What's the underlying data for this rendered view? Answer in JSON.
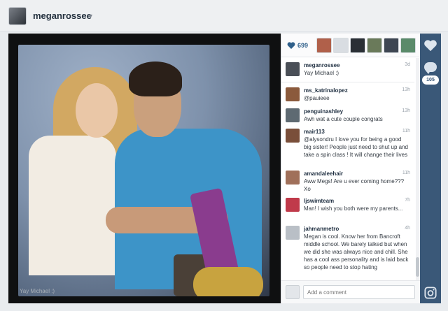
{
  "header": {
    "username": "meganrossee",
    "caret": "▾"
  },
  "photo": {
    "caption_overlay": "Yay Michael :)"
  },
  "likes": {
    "count": "699"
  },
  "comments": [
    {
      "user": "meganrossee",
      "text": "Yay Michael :)",
      "time": "3d",
      "avatar_color": "#4a4f57"
    },
    {
      "user": "ms_katrinalopez",
      "text": "@pauieee",
      "time": "13h",
      "avatar_color": "#8b5a3c"
    },
    {
      "user": "penguinashley",
      "text": "Awh wat a cute couple congrats",
      "time": "13h",
      "avatar_color": "#5e6a72"
    },
    {
      "user": "mair113",
      "text": "@alysondru I love you for being a good big sister! People just need to shut up and take a spin class ! It will change their lives",
      "time": "11h",
      "avatar_color": "#7a4f3a"
    },
    {
      "user": "amandaleehair",
      "text": "Aww Megs! Are u ever coming home??? Xo",
      "time": "11h",
      "avatar_color": "#a0705a"
    },
    {
      "user": "ljswimteam",
      "text": "Man! I wish you both were my parents...",
      "time": "7h",
      "avatar_color": "#c03a4a"
    },
    {
      "user": "jahmanmetro",
      "text": "Megan is cool. Know her from Bancroft middle school. We barely talked but when we did she was always nice and chill. She has a cool ass personality and is laid back so people need to stop hating",
      "time": "4h",
      "avatar_color": "#b9bfc6"
    }
  ],
  "add_comment": {
    "placeholder": "Add a comment"
  },
  "rail": {
    "comment_count": "105"
  },
  "colors": {
    "rail": "#3a5878",
    "like": "#2f5f8a"
  }
}
